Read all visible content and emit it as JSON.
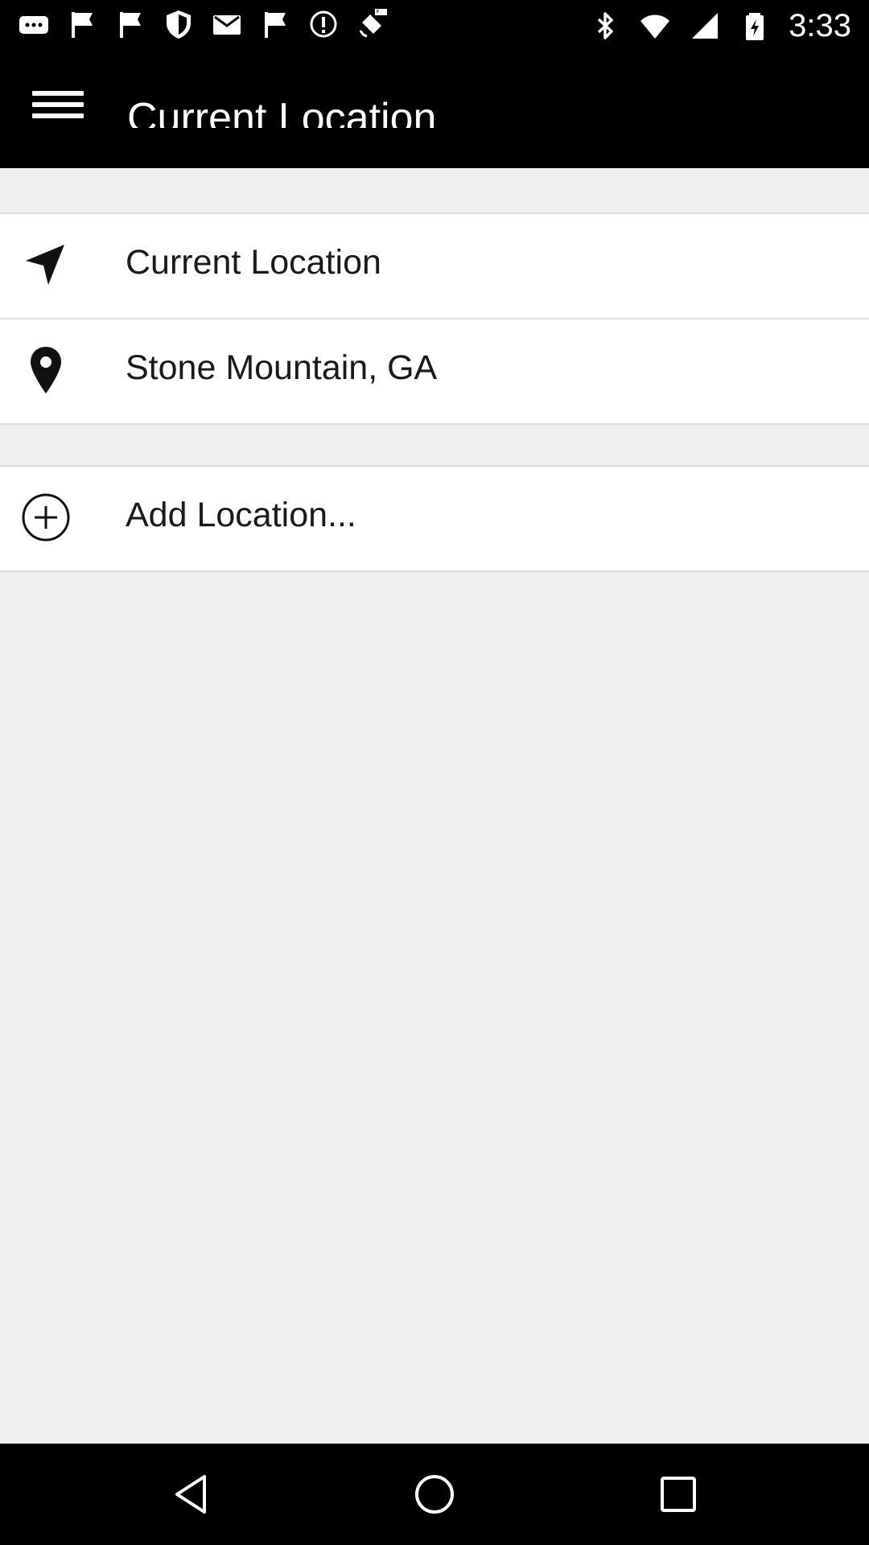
{
  "status_bar": {
    "time": "3:33",
    "icons_left": [
      "more-notifications-icon",
      "flag-icon",
      "flag-icon",
      "shield-icon",
      "mail-icon",
      "flag-icon",
      "info-icon",
      "gps-fake-icon"
    ],
    "icons_right": [
      "bluetooth-icon",
      "wifi-icon",
      "signal-icon",
      "battery-icon"
    ]
  },
  "app_bar": {
    "title": "Current Location",
    "menu_icon": "hamburger-menu-icon"
  },
  "locations": [
    {
      "label": "Current Location",
      "icon": "navigation-arrow-icon"
    },
    {
      "label": "Stone Mountain, GA",
      "icon": "map-pin-icon"
    }
  ],
  "add_location": {
    "label": "Add Location...",
    "icon": "add-circle-icon"
  },
  "nav_bar": {
    "buttons": [
      "back",
      "home",
      "recents"
    ]
  },
  "colors": {
    "bar_background": "#000000",
    "page_background": "#efefef",
    "list_background": "#ffffff",
    "divider": "#dddddd",
    "text": "#1a1a1a"
  }
}
